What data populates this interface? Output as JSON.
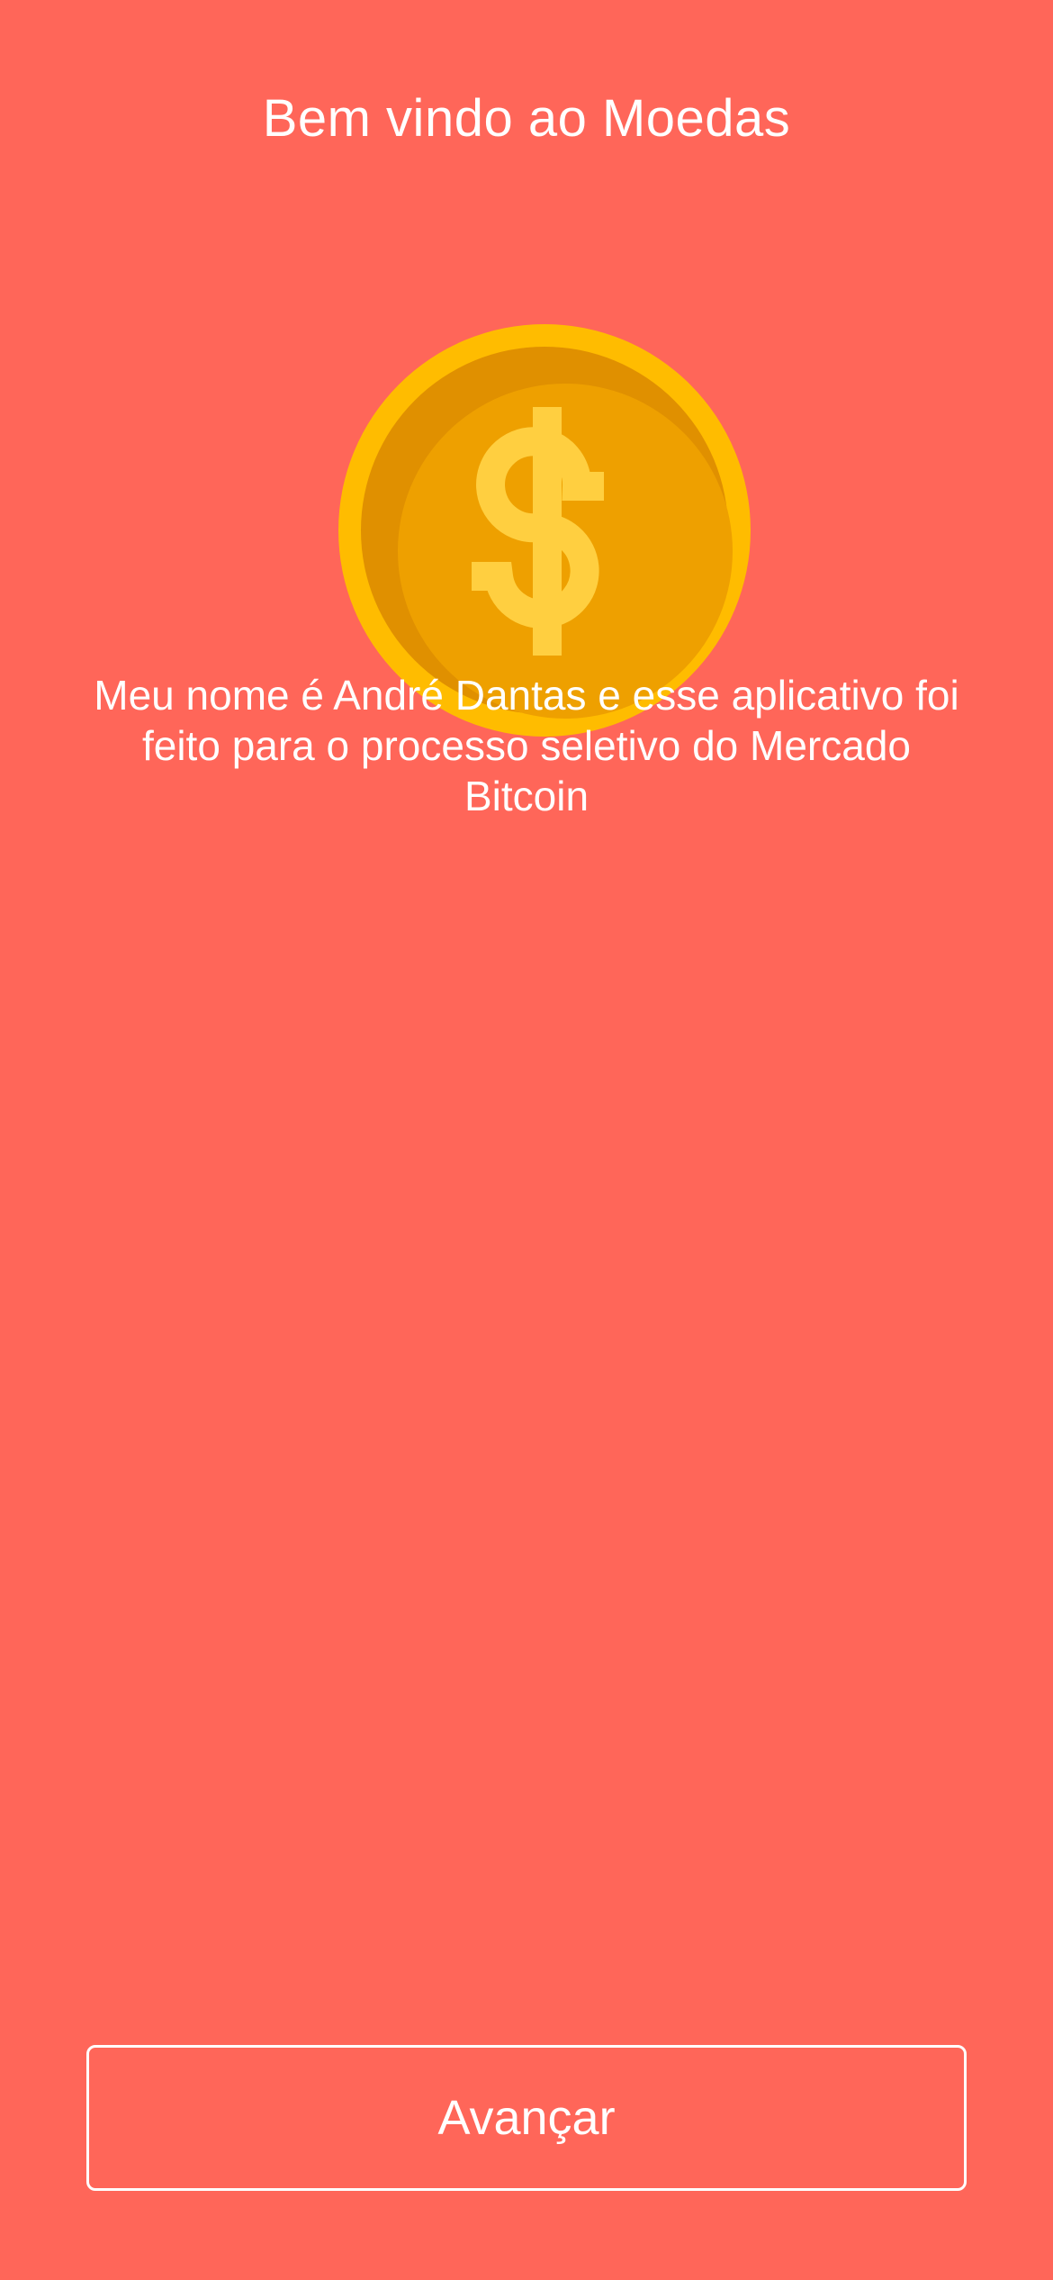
{
  "theme": {
    "background": "#FF6659",
    "text_color": "#FFFFFF",
    "coin_rim": "#FFBC00",
    "coin_face": "#EEA000",
    "coin_shadow": "#E09000",
    "dollar_sign": "#FFCF40"
  },
  "welcome": {
    "title": "Bem vindo ao Moedas",
    "coin_icon": "dollar-coin-icon",
    "intro_text": "Meu nome é André Dantas e esse aplicativo foi feito para o processo seletivo do Mercado Bitcoin"
  },
  "actions": {
    "next_label": "Avançar"
  }
}
